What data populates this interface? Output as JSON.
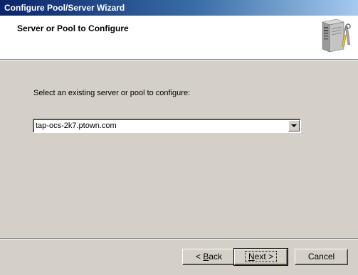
{
  "window": {
    "title": "Configure Pool/Server Wizard"
  },
  "header": {
    "title": "Server or Pool to Configure",
    "icon": "server-with-tools-icon"
  },
  "main": {
    "prompt": "Select an existing server or pool to configure:",
    "server_select": {
      "selected_value": "tap-ocs-2k7.ptown.com"
    }
  },
  "buttons": {
    "back_prefix": "< ",
    "back_mnemonic": "B",
    "back_rest": "ack",
    "next_mnemonic": "N",
    "next_rest": "ext >",
    "cancel_label": "Cancel"
  },
  "colors": {
    "window_bg": "#d4d0c8",
    "titlebar_start": "#0a246a",
    "titlebar_end": "#a6caf0",
    "header_bg": "#ffffff"
  }
}
